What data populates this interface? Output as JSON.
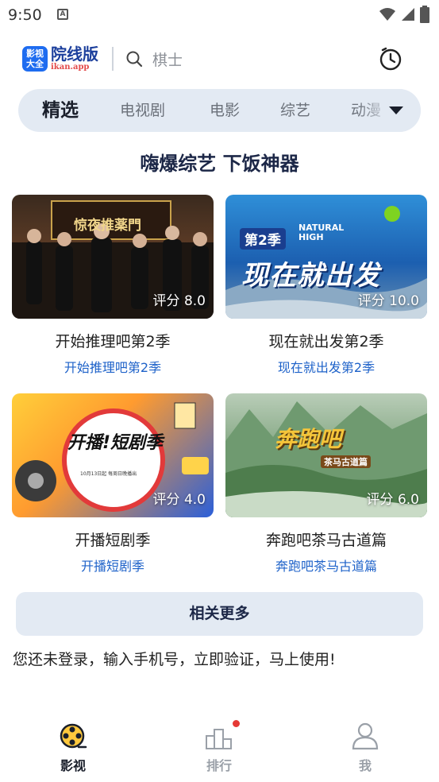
{
  "status_bar": {
    "time": "9:50"
  },
  "header": {
    "logo_badge_line1": "影视",
    "logo_badge_line2": "大全",
    "logo_title": "院线版",
    "logo_domain": "ikan.app",
    "search_placeholder": "棋士"
  },
  "tabs": [
    {
      "label": "精选",
      "active": true
    },
    {
      "label": "电视剧",
      "active": false
    },
    {
      "label": "电影",
      "active": false
    },
    {
      "label": "综艺",
      "active": false
    },
    {
      "label": "动漫",
      "active": false
    }
  ],
  "section_title": "嗨爆综艺 下饭神器",
  "cards": [
    {
      "title": "开始推理吧第2季",
      "subtitle": "开始推理吧第2季",
      "rating": "评分 8.0",
      "poster_text": "惊夜推薬門"
    },
    {
      "title": "现在就出发第2季",
      "subtitle": "现在就出发第2季",
      "rating": "评分 10.0",
      "poster_text": "现在就出发",
      "poster_badge": "第2季",
      "poster_en": "NATURAL HIGH"
    },
    {
      "title": "开播短剧季",
      "subtitle": "开播短剧季",
      "rating": "评分 4.0",
      "poster_text": "开播!短剧季",
      "poster_date": "10月13日起 每周日晚播出"
    },
    {
      "title": "奔跑吧茶马古道篇",
      "subtitle": "奔跑吧茶马古道篇",
      "rating": "评分 6.0",
      "poster_text": "奔跑吧",
      "poster_sub": "茶马古道篇"
    }
  ],
  "more_button": "相关更多",
  "login_tip": "您还未登录，输入手机号，立即验证，马上使用!",
  "bottom_nav": [
    {
      "label": "影视",
      "icon": "film-reel-icon",
      "active": true
    },
    {
      "label": "排行",
      "icon": "podium-icon",
      "active": false,
      "badge_dot": true
    },
    {
      "label": "我",
      "icon": "user-icon",
      "active": false
    }
  ],
  "colors": {
    "accent": "#1e62c9",
    "tab_bg": "#e3eaf3",
    "badge": "#e53935"
  }
}
